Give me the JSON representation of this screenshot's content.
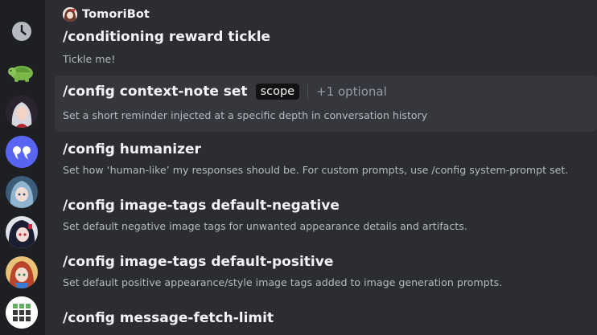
{
  "bot": {
    "name": "TomoriBot"
  },
  "commands": [
    {
      "name": "/conditioning reward tickle",
      "description": "Tickle me!"
    },
    {
      "name": "/config context-note set",
      "description": "Set a short reminder injected at a specific depth in conversation history",
      "param": "scope",
      "optional": "+1 optional"
    },
    {
      "name": "/config humanizer",
      "description": "Set how ‘human-like’ my responses should be. For custom prompts, use /config system-prompt set."
    },
    {
      "name": "/config image-tags default-negative",
      "description": "Set default negative image tags for unwanted appearance details and artifacts."
    },
    {
      "name": "/config image-tags default-positive",
      "description": "Set default positive appearance/style image tags added to image generation prompts."
    },
    {
      "name": "/config message-fetch-limit",
      "description": ""
    }
  ],
  "colors": {
    "rail": "#1e1f22",
    "main": "#2b2d31",
    "highlight": "#36373d",
    "accent": "#5865f2"
  }
}
